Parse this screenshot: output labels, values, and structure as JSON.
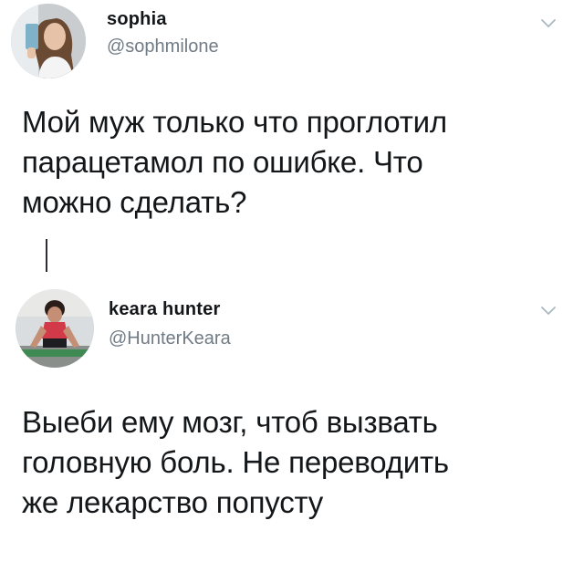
{
  "tweets": [
    {
      "name": "sophia",
      "handle": "@sophmilone",
      "text_lines": [
        "Мой муж только что проглотил",
        "парацетамол по ошибке. Что",
        "можно сделать?"
      ],
      "menu_icon": "chevron-down-icon"
    },
    {
      "name": "keara hunter",
      "handle": "@HunterKeara",
      "text_lines": [
        "Выеби ему мозг, чтоб вызвать",
        "головную боль. Не переводить",
        "же лекарство попусту"
      ],
      "menu_icon": "chevron-down-icon"
    }
  ],
  "colors": {
    "text": "#14171a",
    "secondary": "#707b85",
    "background": "#ffffff",
    "caret": "#aab8c2"
  }
}
